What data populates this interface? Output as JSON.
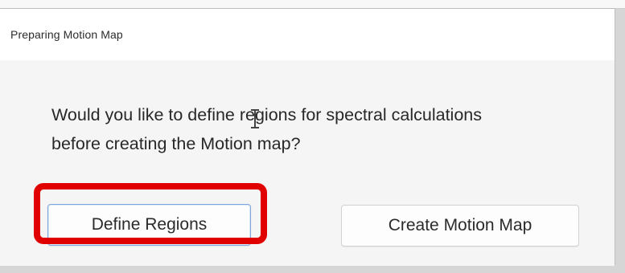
{
  "dialog": {
    "title": "Preparing Motion Map",
    "message": "Would you like to define regions for spectral calculations\nbefore creating the Motion map?"
  },
  "buttons": {
    "define": "Define Regions",
    "create": "Create Motion Map"
  },
  "annotation": {
    "highlight_color": "#e10000"
  }
}
